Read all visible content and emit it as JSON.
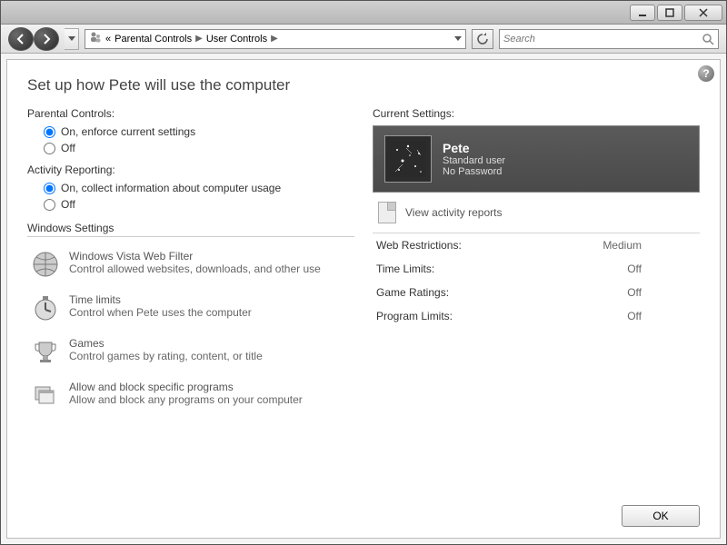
{
  "breadcrumb": {
    "prefix": "«",
    "items": [
      "Parental Controls",
      "User Controls"
    ]
  },
  "search": {
    "placeholder": "Search"
  },
  "page": {
    "title": "Set up how Pete will use the computer"
  },
  "parental_controls": {
    "label": "Parental Controls:",
    "options": {
      "on": "On, enforce current settings",
      "off": "Off"
    },
    "selected": "on"
  },
  "activity_reporting": {
    "label": "Activity Reporting:",
    "options": {
      "on": "On, collect information about computer usage",
      "off": "Off"
    },
    "selected": "on"
  },
  "windows_settings": {
    "label": "Windows Settings",
    "items": [
      {
        "title": "Windows Vista Web Filter",
        "desc": "Control allowed websites, downloads, and other use",
        "icon": "globe-icon"
      },
      {
        "title": "Time limits",
        "desc": "Control when Pete uses the computer",
        "icon": "stopwatch-icon"
      },
      {
        "title": "Games",
        "desc": "Control games by rating, content, or title",
        "icon": "trophy-icon"
      },
      {
        "title": "Allow and block specific programs",
        "desc": "Allow and block any programs on your computer",
        "icon": "window-stack-icon"
      }
    ]
  },
  "current_settings": {
    "label": "Current Settings:",
    "user": {
      "name": "Pete",
      "role": "Standard user",
      "password": "No Password"
    },
    "activity_link": "View activity reports",
    "rows": [
      {
        "k": "Web Restrictions:",
        "v": "Medium"
      },
      {
        "k": "Time Limits:",
        "v": "Off"
      },
      {
        "k": "Game Ratings:",
        "v": "Off"
      },
      {
        "k": "Program Limits:",
        "v": "Off"
      }
    ]
  },
  "buttons": {
    "ok": "OK"
  }
}
